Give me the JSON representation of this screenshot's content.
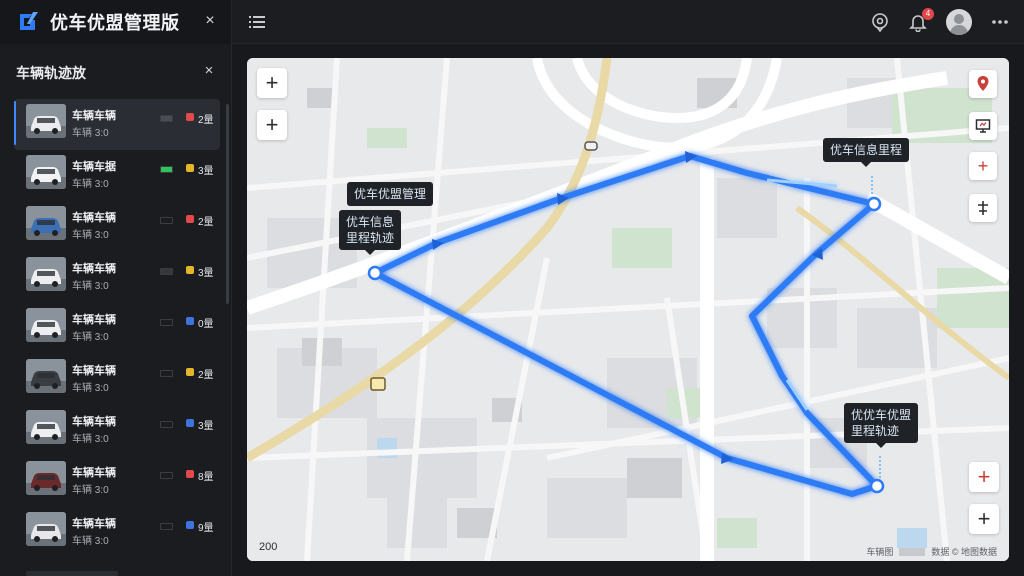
{
  "app": {
    "title": "优车优盟管理版",
    "close_glyph": "×",
    "menu_icon": "menu-icon"
  },
  "topbar": {
    "icons": [
      "location-icon",
      "bell-icon",
      "avatar",
      "more-icon"
    ],
    "notification_count": "4"
  },
  "panel": {
    "title": "车辆轨迹放",
    "close_glyph": "×"
  },
  "vehicles": [
    {
      "name": "车辆车辆",
      "sub": "车辆 3:0",
      "count": "2量",
      "status_color": "#e04a4a",
      "battery_color": "#4a4d52",
      "car_color": "#e9ebee",
      "active": true
    },
    {
      "name": "车辆车据",
      "sub": "车辆 3:0",
      "count": "3量",
      "status_color": "#e5b52c",
      "battery_color": "#2ec45a",
      "car_color": "#f1f2f4",
      "active": false
    },
    {
      "name": "车辆车辆",
      "sub": "车辆 3:0",
      "count": "2量",
      "status_color": "#e04a4a",
      "battery_color": "#1a1c20",
      "car_color": "#3d6fb5",
      "active": false
    },
    {
      "name": "车辆车辆",
      "sub": "车辆 3:0",
      "count": "3量",
      "status_color": "#e5b52c",
      "battery_color": "#34373c",
      "car_color": "#eceef0",
      "active": false
    },
    {
      "name": "车辆车辆",
      "sub": "车辆 3:0",
      "count": "0量",
      "status_color": "#3e74e0",
      "battery_color": "#1a1c20",
      "car_color": "#eceef0",
      "active": false
    },
    {
      "name": "车辆车辆",
      "sub": "车辆 3:0",
      "count": "2量",
      "status_color": "#e5b52c",
      "battery_color": "#1a1c20",
      "car_color": "#3a3d42",
      "active": false
    },
    {
      "name": "车辆车辆",
      "sub": "车辆 3:0",
      "count": "3量",
      "status_color": "#3e74e0",
      "battery_color": "#1a1c20",
      "car_color": "#eceef0",
      "active": false
    },
    {
      "name": "车辆车辆",
      "sub": "车辆 3:0",
      "count": "8量",
      "status_color": "#e04a4a",
      "battery_color": "#1a1c20",
      "car_color": "#6b2a2a",
      "active": false
    },
    {
      "name": "车辆车辆",
      "sub": "车辆 3:0",
      "count": "9量",
      "status_color": "#3e74e0",
      "battery_color": "#1a1c20",
      "car_color": "#e5e7ea",
      "active": false
    }
  ],
  "map": {
    "controls_left": [
      "+",
      "+"
    ],
    "controls_right": [
      "location-pin-icon",
      "screen-icon",
      "+",
      "compass-icon"
    ],
    "controls_bottom_right": [
      "+",
      "+"
    ],
    "callouts": [
      {
        "id": "stop-a",
        "lines": [
          "优车优盟管理"
        ]
      },
      {
        "id": "stop-a-detail",
        "lines": [
          "优车信息",
          "里程轨迹"
        ]
      },
      {
        "id": "stop-b",
        "lines": [
          "优车信息里程"
        ]
      },
      {
        "id": "stop-c",
        "lines": [
          "优优车优盟",
          "里程轨迹"
        ]
      }
    ],
    "scale_label": "200",
    "attribution": [
      "车辆图",
      "数据 © 地图数据"
    ],
    "route_color": "#2f7bf5"
  }
}
